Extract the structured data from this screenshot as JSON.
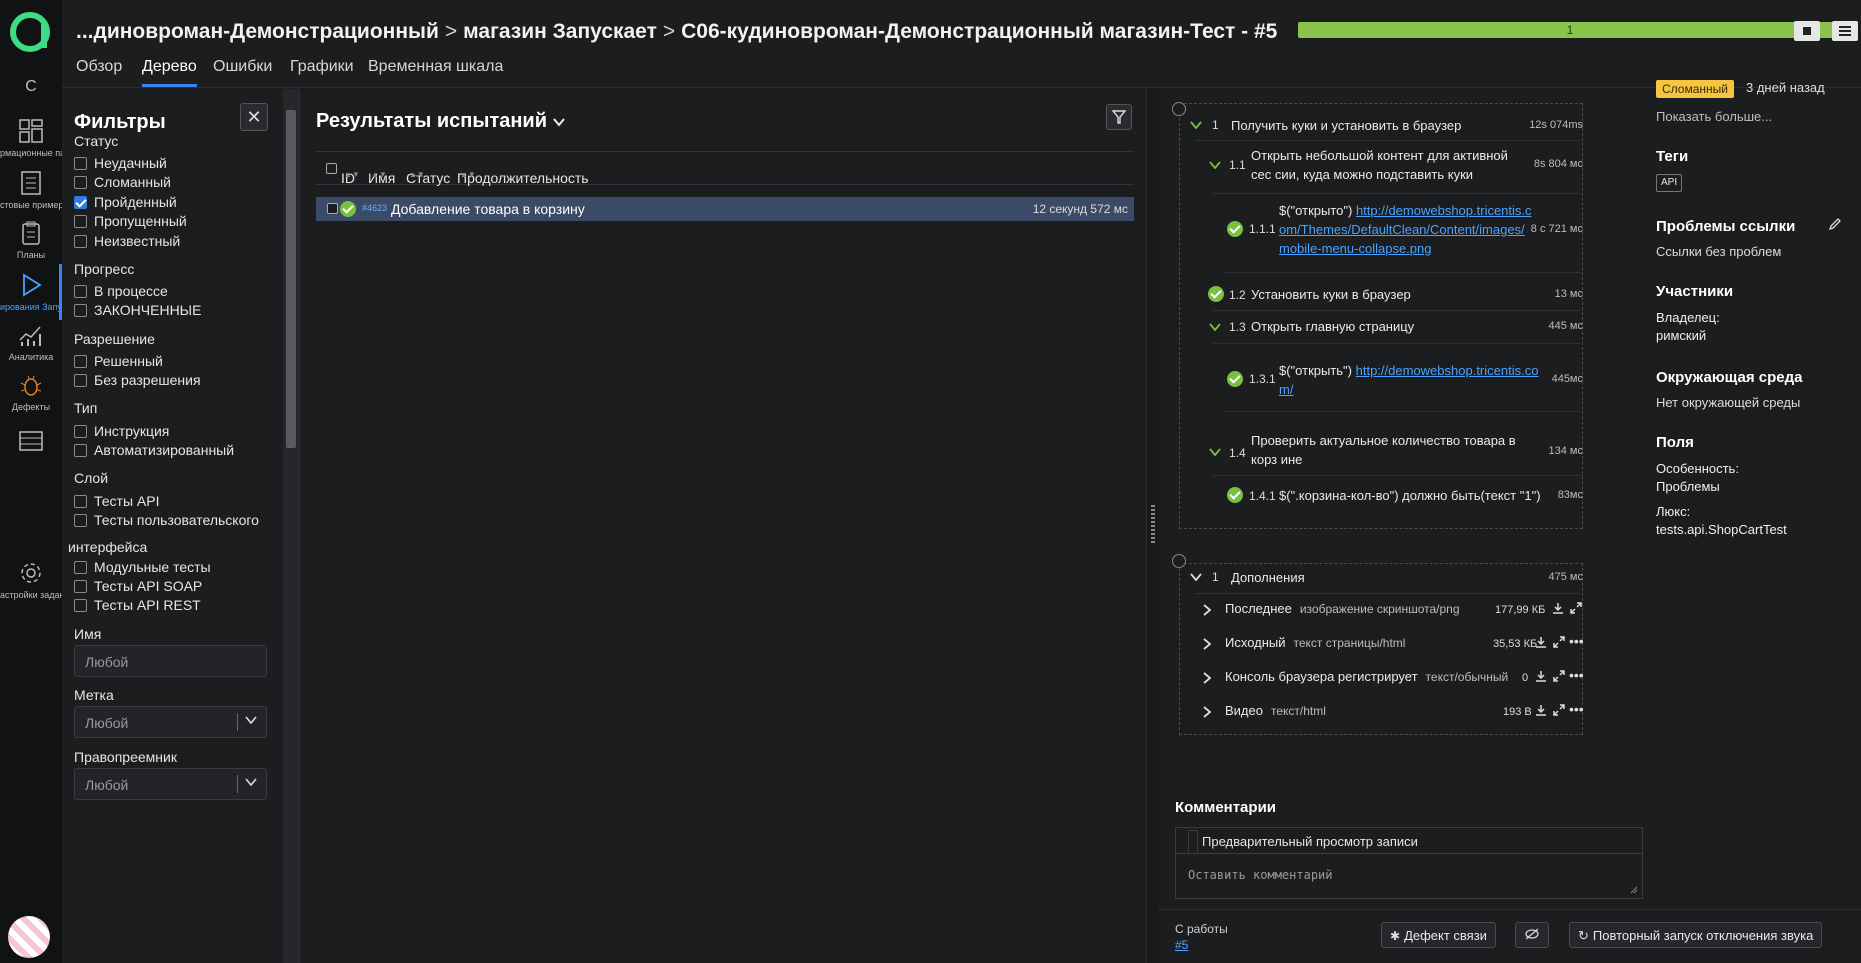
{
  "breadcrumb": {
    "part1": "...диновроман-Демонстрационный",
    "part2": "магазин Запускает",
    "part3": "C06-кудиновроман-Демонстрационный магазин-Тест - #5",
    "separator": ">"
  },
  "progress_label": "1",
  "progress_fraction": 1.0,
  "tabs": [
    "Обзор",
    "Дерево",
    "Ошибки",
    "Графики",
    "Временная шкала"
  ],
  "active_tab": "Дерево",
  "sidebar": {
    "top_letter": "C",
    "items": [
      {
        "label": "рмационные панели",
        "icon": "dashboard-icon"
      },
      {
        "label": "стовые примеры",
        "icon": "test-cases-icon"
      },
      {
        "label": "Планы",
        "icon": "plans-icon"
      },
      {
        "label": "ирования Запуски",
        "icon": "launches-icon"
      },
      {
        "label": "Аналитика",
        "icon": "analytics-icon"
      },
      {
        "label": "Дефекты",
        "icon": "bug-icon"
      },
      {
        "label": "",
        "icon": "table-icon"
      },
      {
        "label": "астройки заданий",
        "icon": "gear-icon"
      }
    ]
  },
  "filters": {
    "title": "Фильтры",
    "sections": {
      "status": {
        "label": "Статус",
        "options": [
          "Неудачный",
          "Сломанный",
          "Пройденный",
          "Пропущенный",
          "Неизвестный"
        ],
        "checked": "Пройденный"
      },
      "progress": {
        "label": "Прогресс",
        "options": [
          "В процессе",
          "ЗАКОНЧЕННЫЕ"
        ]
      },
      "resolution": {
        "label": "Разрешение",
        "options": [
          "Решенный",
          "Без разрешения"
        ]
      },
      "type": {
        "label": "Тип",
        "options": [
          "Инструкция",
          "Автоматизированный"
        ]
      },
      "layer": {
        "label": "Слой",
        "options": [
          "Тесты API",
          "Тесты пользовательского"
        ],
        "continuation": "интерфейса",
        "more": [
          "Модульные тесты",
          "Тесты API SOAP",
          "Тесты API REST"
        ]
      }
    },
    "name_label": "Имя",
    "name_placeholder": "Любой",
    "tag_label": "Метка",
    "tag_value": "Любой",
    "assignee_label": "Правопреемник",
    "assignee_value": "Любой"
  },
  "results": {
    "title": "Результаты испытаний",
    "columns": [
      "ID",
      "Имя",
      "Статус",
      "Продолжительность"
    ],
    "rows": [
      {
        "id": "#4623",
        "name": "Добавление товара в корзину",
        "duration": "12 секунд 572 мс",
        "status": "passed"
      }
    ]
  },
  "steps": [
    {
      "num": "1",
      "text": "Получить куки и установить в браузер",
      "dur": "12s 074ms"
    },
    {
      "num": "1.1",
      "text": "Открыть небольшой контент для активной сес сии, куда можно подставить куки",
      "dur": "8s 804 мс"
    },
    {
      "num": "1.1.1",
      "text_prefix": "$(\"открыто\") ",
      "link": "http://demowebshop.tricentis.com/Themes/DefaultClean/Content/images/mobile-menu-collapse.png",
      "link_lines": [
        "http://demowebshop.tricentis.c",
        "om/Themes/DefaultClean/Content/images/",
        "mobile-menu-collapse.png"
      ],
      "dur": "8 с 721 мс"
    },
    {
      "num": "1.2",
      "text": "Установить куки в браузер",
      "dur": "13 мс"
    },
    {
      "num": "1.3",
      "text": "Открыть главную страницу",
      "dur": "445 мс"
    },
    {
      "num": "1.3.1",
      "text_prefix": "$(\"открыть\") ",
      "link_lines": [
        "http://demowebshop.tricentis.co",
        "m/"
      ],
      "dur": "445мс"
    },
    {
      "num": "1.4",
      "text": "Проверить актуальное количество товара в корз ине",
      "dur": "134 мс"
    },
    {
      "num": "1.4.1",
      "text": "$(\".корзина-кол-во\") должно быть(текст \"1\")",
      "dur": "83мс"
    }
  ],
  "attachments_group": {
    "num": "1",
    "label": "Дополнения",
    "dur": "475 мс"
  },
  "attachments": [
    {
      "name": "Последнее",
      "mime": "изображение скриншота/png",
      "size": "177,99 КБ"
    },
    {
      "name": "Исходный",
      "mime": "текст страницы/html",
      "size": "35,53 КБ"
    },
    {
      "name": "Консоль браузера регистрирует",
      "mime": "текст/обычный",
      "size": "0"
    },
    {
      "name": "Видео",
      "mime": "текст/html",
      "size": "193 В"
    }
  ],
  "comments": {
    "title": "Комментарии",
    "preview_tab": "Предварительный просмотр записи",
    "placeholder": "Оставить комментарий"
  },
  "footer": {
    "from_label": "С работы",
    "from_link": "#5",
    "link_defect": "Дефект связи",
    "rerun": "Повторный запуск отключения звука"
  },
  "meta": {
    "status_badge": "Сломанный",
    "time_ago": "3 дней назад",
    "show_more": "Показать больше...",
    "tags_title": "Теги",
    "tag": "API",
    "issues_title": "Проблемы ссылки",
    "issues_text": "Ссылки без проблем",
    "members_title": "Участники",
    "owner_label": "Владелец:",
    "owner": "римский",
    "env_title": "Окружающая среда",
    "env_text": "Нет окружающей среды",
    "fields_title": "Поля",
    "feature_label": "Особенность:",
    "feature": "Проблемы",
    "suite_label": "Люкс:",
    "suite": "tests.api.ShopCartTest"
  },
  "colors": {
    "accent": "#3b82f6",
    "passed": "#7ac142",
    "progress": "#8bc34a",
    "selected_row": "#3b4a66"
  }
}
